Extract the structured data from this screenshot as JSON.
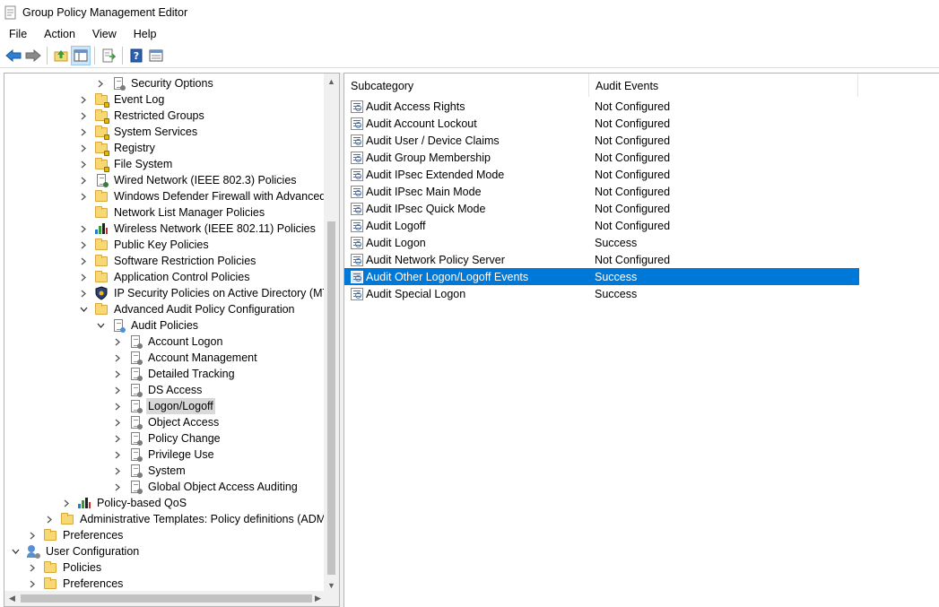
{
  "window": {
    "title": "Group Policy Management Editor"
  },
  "menu": [
    "File",
    "Action",
    "View",
    "Help"
  ],
  "toolbar": {
    "buttons": [
      "back-arrow-icon",
      "forward-arrow-icon",
      "up-folder-icon",
      "show-hide-tree-icon",
      "export-list-icon",
      "help-icon",
      "properties-icon"
    ]
  },
  "tree": [
    {
      "label": "Security Options",
      "indent": 5,
      "expander": "collapsed",
      "icon": "policy"
    },
    {
      "label": "Event Log",
      "indent": 4,
      "expander": "collapsed",
      "icon": "folder-lock"
    },
    {
      "label": "Restricted Groups",
      "indent": 4,
      "expander": "collapsed",
      "icon": "folder-lock"
    },
    {
      "label": "System Services",
      "indent": 4,
      "expander": "collapsed",
      "icon": "folder-lock"
    },
    {
      "label": "Registry",
      "indent": 4,
      "expander": "collapsed",
      "icon": "folder-lock"
    },
    {
      "label": "File System",
      "indent": 4,
      "expander": "collapsed",
      "icon": "folder-lock"
    },
    {
      "label": "Wired Network (IEEE 802.3) Policies",
      "indent": 4,
      "expander": "collapsed",
      "icon": "network"
    },
    {
      "label": "Windows Defender Firewall with Advanced Security",
      "indent": 4,
      "expander": "collapsed",
      "icon": "folder"
    },
    {
      "label": "Network List Manager Policies",
      "indent": 4,
      "expander": "none",
      "icon": "folder"
    },
    {
      "label": "Wireless Network (IEEE 802.11) Policies",
      "indent": 4,
      "expander": "collapsed",
      "icon": "bars"
    },
    {
      "label": "Public Key Policies",
      "indent": 4,
      "expander": "collapsed",
      "icon": "folder"
    },
    {
      "label": "Software Restriction Policies",
      "indent": 4,
      "expander": "collapsed",
      "icon": "folder"
    },
    {
      "label": "Application Control Policies",
      "indent": 4,
      "expander": "collapsed",
      "icon": "folder"
    },
    {
      "label": "IP Security Policies on Active Directory (MTLAB)",
      "indent": 4,
      "expander": "collapsed",
      "icon": "ipsec"
    },
    {
      "label": "Advanced Audit Policy Configuration",
      "indent": 4,
      "expander": "expanded",
      "icon": "folder"
    },
    {
      "label": "Audit Policies",
      "indent": 5,
      "expander": "expanded",
      "icon": "audit"
    },
    {
      "label": "Account Logon",
      "indent": 6,
      "expander": "collapsed",
      "icon": "policy"
    },
    {
      "label": "Account Management",
      "indent": 6,
      "expander": "collapsed",
      "icon": "policy"
    },
    {
      "label": "Detailed Tracking",
      "indent": 6,
      "expander": "collapsed",
      "icon": "policy"
    },
    {
      "label": "DS Access",
      "indent": 6,
      "expander": "collapsed",
      "icon": "policy"
    },
    {
      "label": "Logon/Logoff",
      "indent": 6,
      "expander": "collapsed",
      "icon": "policy",
      "selected": true
    },
    {
      "label": "Object Access",
      "indent": 6,
      "expander": "collapsed",
      "icon": "policy"
    },
    {
      "label": "Policy Change",
      "indent": 6,
      "expander": "collapsed",
      "icon": "policy"
    },
    {
      "label": "Privilege Use",
      "indent": 6,
      "expander": "collapsed",
      "icon": "policy"
    },
    {
      "label": "System",
      "indent": 6,
      "expander": "collapsed",
      "icon": "policy"
    },
    {
      "label": "Global Object Access Auditing",
      "indent": 6,
      "expander": "collapsed",
      "icon": "policy"
    },
    {
      "label": "Policy-based QoS",
      "indent": 3,
      "expander": "collapsed",
      "icon": "bars"
    },
    {
      "label": "Administrative Templates: Policy definitions (ADMX files)",
      "indent": 2,
      "expander": "collapsed",
      "icon": "folder"
    },
    {
      "label": "Preferences",
      "indent": 1,
      "expander": "collapsed",
      "icon": "folder"
    },
    {
      "label": "User Configuration",
      "indent": 0,
      "expander": "expanded",
      "icon": "user"
    },
    {
      "label": "Policies",
      "indent": 1,
      "expander": "collapsed",
      "icon": "folder"
    },
    {
      "label": "Preferences",
      "indent": 1,
      "expander": "collapsed",
      "icon": "folder"
    }
  ],
  "list": {
    "columns": [
      "Subcategory",
      "Audit Events"
    ],
    "rows": [
      {
        "subcategory": "Audit Access Rights",
        "events": "Not Configured"
      },
      {
        "subcategory": "Audit Account Lockout",
        "events": "Not Configured"
      },
      {
        "subcategory": "Audit User / Device Claims",
        "events": "Not Configured"
      },
      {
        "subcategory": "Audit Group Membership",
        "events": "Not Configured"
      },
      {
        "subcategory": "Audit IPsec Extended Mode",
        "events": "Not Configured"
      },
      {
        "subcategory": "Audit IPsec Main Mode",
        "events": "Not Configured"
      },
      {
        "subcategory": "Audit IPsec Quick Mode",
        "events": "Not Configured"
      },
      {
        "subcategory": "Audit Logoff",
        "events": "Not Configured"
      },
      {
        "subcategory": "Audit Logon",
        "events": "Success"
      },
      {
        "subcategory": "Audit Network Policy Server",
        "events": "Not Configured"
      },
      {
        "subcategory": "Audit Other Logon/Logoff Events",
        "events": "Success",
        "selected": true
      },
      {
        "subcategory": "Audit Special Logon",
        "events": "Success"
      }
    ]
  },
  "colors": {
    "selection": "#0078d7",
    "tree_selection": "#d9d9d9",
    "folder": "#f8d775"
  }
}
